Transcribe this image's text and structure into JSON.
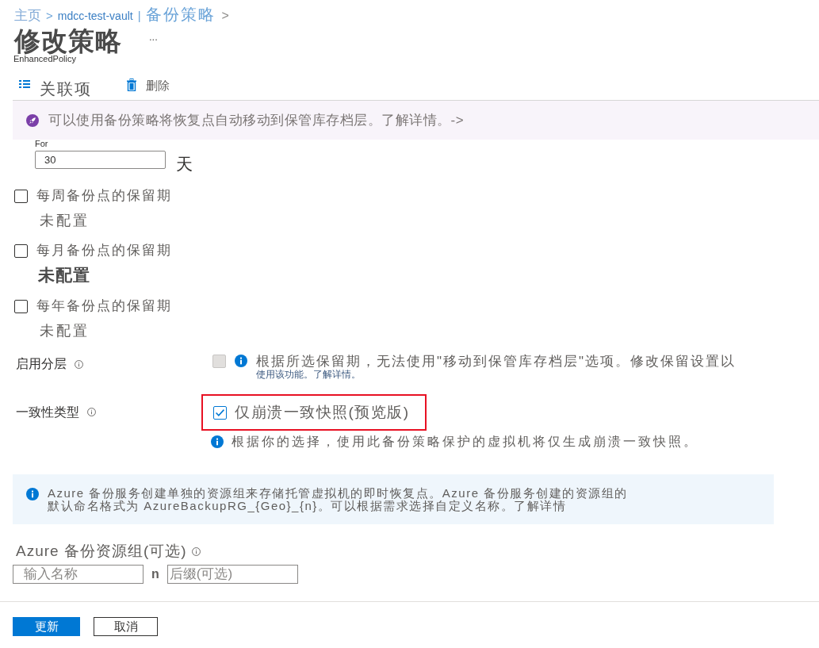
{
  "breadcrumb": [
    {
      "label": "主页",
      "kind": "link"
    },
    {
      "label": ">",
      "kind": "separator"
    },
    {
      "label": "mdcc-test-vault",
      "kind": "link"
    },
    {
      "label": "|",
      "kind": "separator"
    },
    {
      "label": "备份策略",
      "kind": "current"
    },
    {
      "label": ">",
      "kind": "chevron"
    }
  ],
  "page": {
    "title": "修改策略",
    "more": "...",
    "subtitle": "EnhancedPolicy"
  },
  "toolbar": [
    {
      "label": "关联项",
      "kind": "list"
    },
    {
      "label": "删除",
      "kind": "delete"
    }
  ],
  "banner": {
    "text": "可以使用备份策略将恢复点自动移动到保管库存档层。了解详情。->"
  },
  "daily_retention": {
    "label": "For",
    "value": "30",
    "unit": "天"
  },
  "retention_options": [
    {
      "label": "每周备份点的保留期",
      "checked": false,
      "status": "未配置",
      "emphasized": false
    },
    {
      "label": "每月备份点的保留期",
      "checked": false,
      "status": "未配置",
      "emphasized": true
    },
    {
      "label": "每年备份点的保留期",
      "checked": false,
      "status": "未配置",
      "emphasized": false
    }
  ],
  "tiering": {
    "label": "启用分层",
    "checked": false,
    "disabled": true,
    "note_lines": [
      "根据所选保留期，无法使用\"移动到保管库存档层\"选项。修改保留设置以",
      "使用该功能。了解详情。"
    ]
  },
  "consistency": {
    "label": "一致性类型",
    "option": "仅崩溃一致快照(预览版)",
    "checked": true,
    "highlighted": true,
    "note": "根据你的选择，使用此备份策略保护的虚拟机将仅生成崩溃一致快照。"
  },
  "info_box": {
    "lines": [
      "Azure 备份服务创建单独的资源组来存储托管虚拟机的即时恢复点。Azure 备份服务创建的资源组的",
      "默认命名格式为 AzureBackupRG_{Geo}_{n}。可以根据需求选择自定义名称。了解详情"
    ]
  },
  "resource_group": {
    "label": "Azure 备份资源组(可选)",
    "name_placeholder": "输入名称",
    "separator": "n",
    "suffix_placeholder": "后缀(可选)"
  },
  "buttons": [
    {
      "label": "更新",
      "kind": "primary"
    },
    {
      "label": "取消",
      "kind": "secondary"
    }
  ]
}
